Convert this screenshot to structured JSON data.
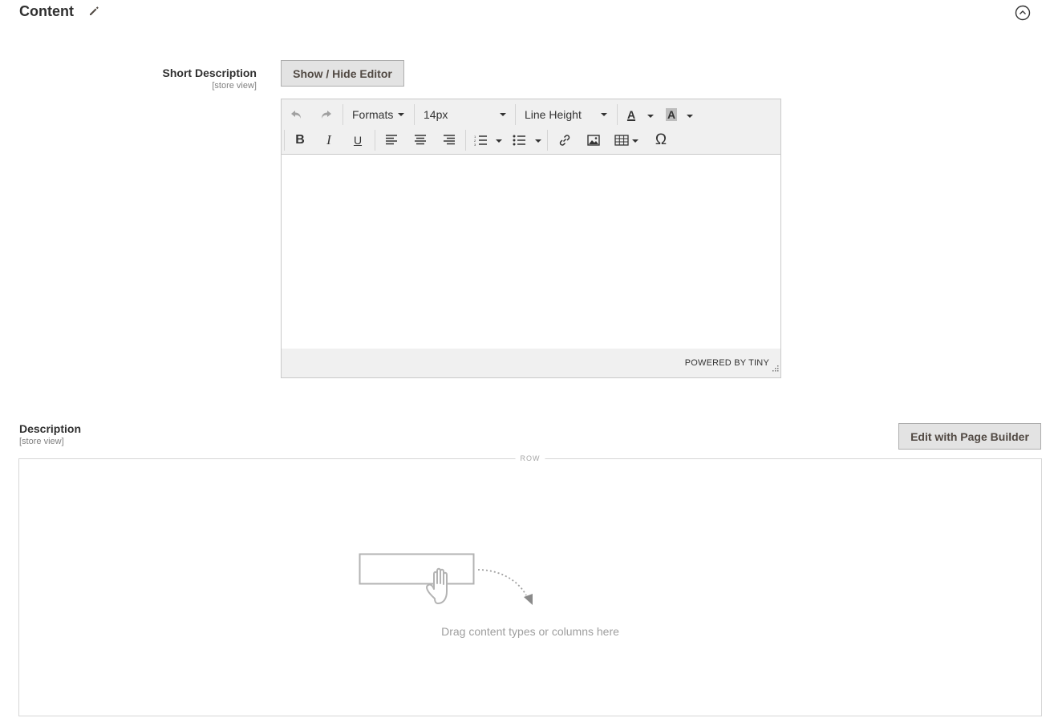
{
  "section": {
    "title": "Content",
    "edit_icon": "pencil-icon",
    "collapse_icon": "chevron-up-circle-icon"
  },
  "short_description": {
    "label": "Short Description",
    "scope": "[store view]",
    "toggle_button": "Show / Hide Editor",
    "editor": {
      "toolbar_row1": {
        "undo_icon": "undo-icon",
        "redo_icon": "redo-icon",
        "formats": "Formats",
        "font_size": "14px",
        "line_height": "Line Height",
        "text_color_glyph": "A",
        "bg_color_glyph": "A"
      },
      "toolbar_row2": {
        "bold": "B",
        "italic": "I",
        "underline": "U",
        "special_char": "Ω"
      },
      "content": "",
      "powered_by": "POWERED BY TINY"
    }
  },
  "description": {
    "label": "Description",
    "scope": "[store view]",
    "page_builder_button": "Edit with Page Builder",
    "stage": {
      "row_label": "ROW",
      "placeholder": "Drag content types or columns here"
    }
  },
  "colors": {
    "button_bg": "#e3e3e3",
    "button_border": "#adadad",
    "toolbar_bg": "#f0f0f0",
    "border": "#c9c9c9",
    "muted_text": "#9e9e9e"
  }
}
